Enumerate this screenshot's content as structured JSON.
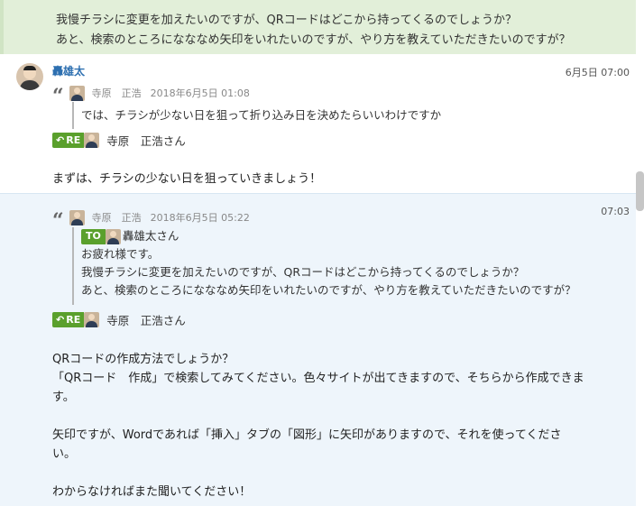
{
  "top_message": {
    "lines": [
      "我慢チラシに変更を加えたいのですが、QRコードはどこから持ってくるのでしょうか？",
      "あと、検索のところになななめ矢印をいれたいのですが、やり方を教えていただきたいのですが？"
    ]
  },
  "message1": {
    "sender": "轟雄太",
    "time": "6月5日 07:00",
    "quote": {
      "name": "寺原　正浩",
      "datetime": "2018年6月5日 01:08",
      "lines": [
        "では、チラシが少ない日を狙って折り込み日を決めたらいいわけですか"
      ]
    },
    "reply": {
      "badge": "RE",
      "name": "寺原　正浩さん"
    },
    "body": [
      "まずは、チラシの少ない日を狙っていきましょう！"
    ]
  },
  "message2": {
    "time": "07:03",
    "quote": {
      "name": "寺原　正浩",
      "datetime": "2018年6月5日 05:22",
      "to_badge": "TO",
      "to_name": "轟雄太さん",
      "lines": [
        "お疲れ様です。",
        "我慢チラシに変更を加えたいのですが、QRコードはどこから持ってくるのでしょうか？",
        "あと、検索のところになななめ矢印をいれたいのですが、やり方を教えていただきたいのですが？"
      ]
    },
    "reply": {
      "badge": "RE",
      "name": "寺原　正浩さん"
    },
    "body": [
      "QRコードの作成方法でしょうか？",
      "「QRコード　作成」で検索してみてください。色々サイトが出てきますので、そちらから作成できま",
      "す。",
      "",
      "矢印ですが、Wordであれば「挿入」タブの「図形」に矢印がありますので、それを使ってくださ",
      "い。",
      "",
      "わからなければまた聞いてください！"
    ]
  },
  "colors": {
    "accent_green": "#5aa02c",
    "sender_blue": "#2d6fb0",
    "highlight_bg": "#e2efd9",
    "block_bg": "#eef5fb"
  }
}
